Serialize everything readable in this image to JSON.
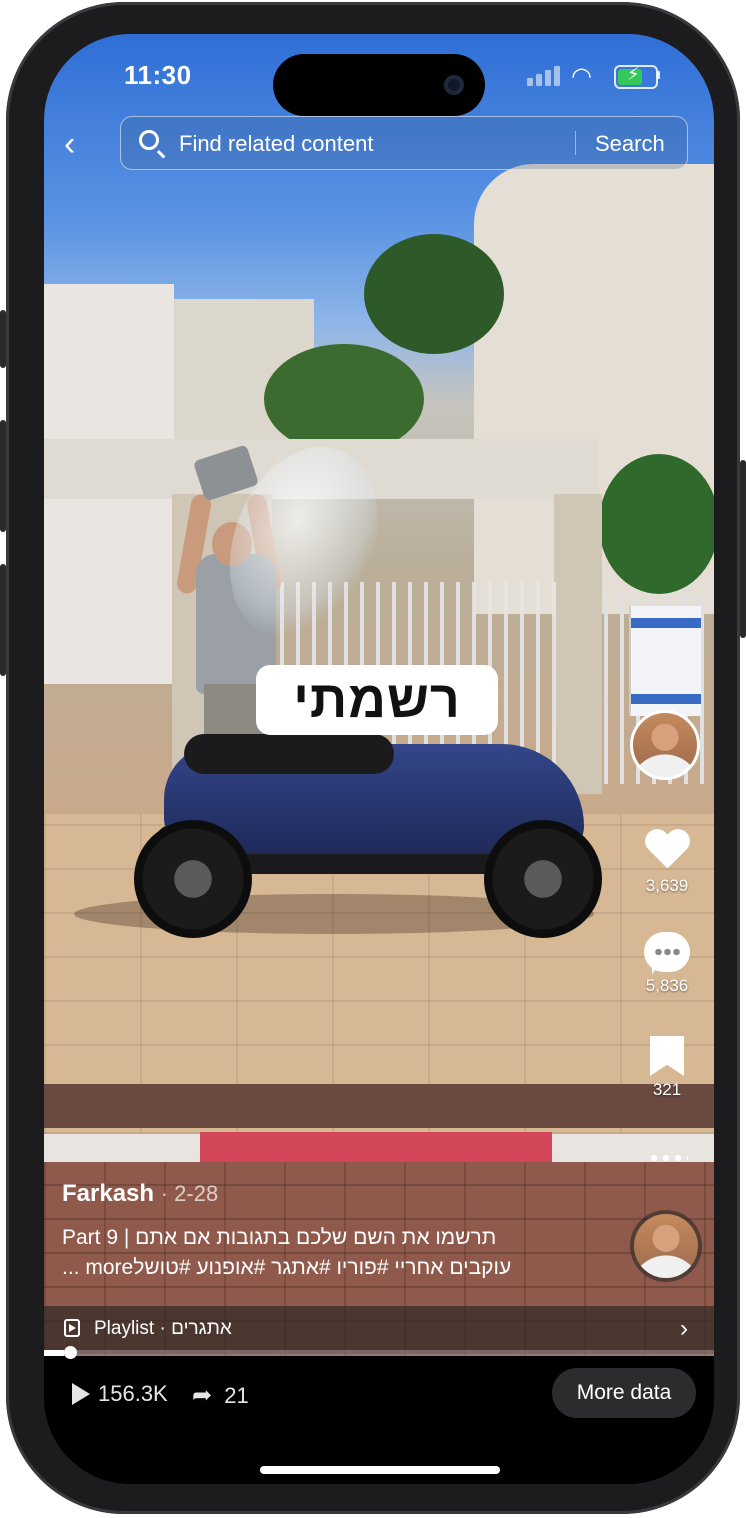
{
  "status_bar": {
    "time": "11:30"
  },
  "search": {
    "placeholder": "Find related content",
    "button_label": "Search"
  },
  "video": {
    "overlay_text": "רשמתי",
    "progress_percent": 3
  },
  "rail": {
    "likes": "3,639",
    "comments": "5,836",
    "saves": "321"
  },
  "caption": {
    "author": "Farkash",
    "date": "· 2-28",
    "line1": "Part 9 | תרשמו את השם שלכם בתגובות אם אתם",
    "line2": "עוקבים אחריי  #פוריו #אתגר #אופנוע #טושלmore ..."
  },
  "playlist": {
    "label": "Playlist · אתגרים"
  },
  "stats": {
    "views": "156.3K",
    "shares": "21"
  },
  "bottom": {
    "more_data_label": "More data"
  },
  "colors": {
    "accent_red_curb": "#d4475a",
    "battery_green": "#34c759"
  }
}
